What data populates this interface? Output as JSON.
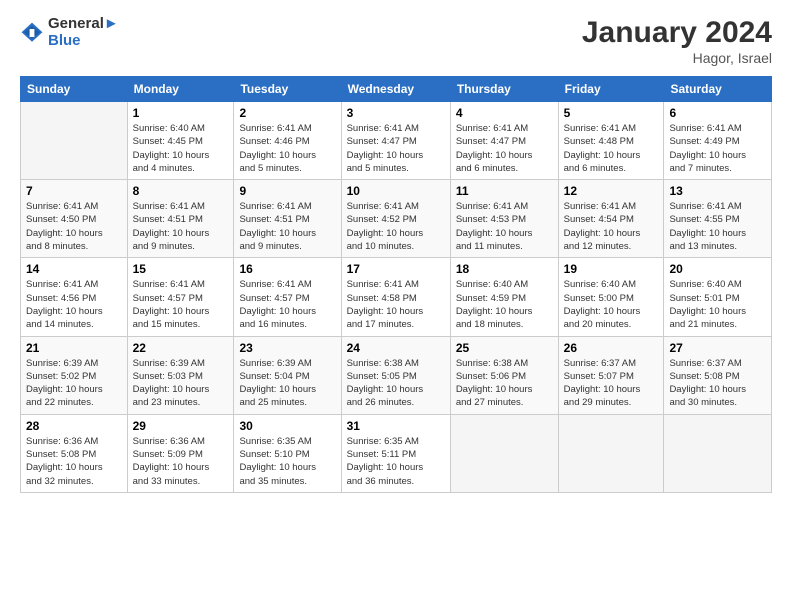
{
  "header": {
    "logo_line1": "General",
    "logo_line2": "Blue",
    "title": "January 2024",
    "subtitle": "Hagor, Israel"
  },
  "columns": [
    "Sunday",
    "Monday",
    "Tuesday",
    "Wednesday",
    "Thursday",
    "Friday",
    "Saturday"
  ],
  "rows": [
    [
      {
        "num": "",
        "info": ""
      },
      {
        "num": "1",
        "info": "Sunrise: 6:40 AM\nSunset: 4:45 PM\nDaylight: 10 hours\nand 4 minutes."
      },
      {
        "num": "2",
        "info": "Sunrise: 6:41 AM\nSunset: 4:46 PM\nDaylight: 10 hours\nand 5 minutes."
      },
      {
        "num": "3",
        "info": "Sunrise: 6:41 AM\nSunset: 4:47 PM\nDaylight: 10 hours\nand 5 minutes."
      },
      {
        "num": "4",
        "info": "Sunrise: 6:41 AM\nSunset: 4:47 PM\nDaylight: 10 hours\nand 6 minutes."
      },
      {
        "num": "5",
        "info": "Sunrise: 6:41 AM\nSunset: 4:48 PM\nDaylight: 10 hours\nand 6 minutes."
      },
      {
        "num": "6",
        "info": "Sunrise: 6:41 AM\nSunset: 4:49 PM\nDaylight: 10 hours\nand 7 minutes."
      }
    ],
    [
      {
        "num": "7",
        "info": "Sunrise: 6:41 AM\nSunset: 4:50 PM\nDaylight: 10 hours\nand 8 minutes."
      },
      {
        "num": "8",
        "info": "Sunrise: 6:41 AM\nSunset: 4:51 PM\nDaylight: 10 hours\nand 9 minutes."
      },
      {
        "num": "9",
        "info": "Sunrise: 6:41 AM\nSunset: 4:51 PM\nDaylight: 10 hours\nand 9 minutes."
      },
      {
        "num": "10",
        "info": "Sunrise: 6:41 AM\nSunset: 4:52 PM\nDaylight: 10 hours\nand 10 minutes."
      },
      {
        "num": "11",
        "info": "Sunrise: 6:41 AM\nSunset: 4:53 PM\nDaylight: 10 hours\nand 11 minutes."
      },
      {
        "num": "12",
        "info": "Sunrise: 6:41 AM\nSunset: 4:54 PM\nDaylight: 10 hours\nand 12 minutes."
      },
      {
        "num": "13",
        "info": "Sunrise: 6:41 AM\nSunset: 4:55 PM\nDaylight: 10 hours\nand 13 minutes."
      }
    ],
    [
      {
        "num": "14",
        "info": "Sunrise: 6:41 AM\nSunset: 4:56 PM\nDaylight: 10 hours\nand 14 minutes."
      },
      {
        "num": "15",
        "info": "Sunrise: 6:41 AM\nSunset: 4:57 PM\nDaylight: 10 hours\nand 15 minutes."
      },
      {
        "num": "16",
        "info": "Sunrise: 6:41 AM\nSunset: 4:57 PM\nDaylight: 10 hours\nand 16 minutes."
      },
      {
        "num": "17",
        "info": "Sunrise: 6:41 AM\nSunset: 4:58 PM\nDaylight: 10 hours\nand 17 minutes."
      },
      {
        "num": "18",
        "info": "Sunrise: 6:40 AM\nSunset: 4:59 PM\nDaylight: 10 hours\nand 18 minutes."
      },
      {
        "num": "19",
        "info": "Sunrise: 6:40 AM\nSunset: 5:00 PM\nDaylight: 10 hours\nand 20 minutes."
      },
      {
        "num": "20",
        "info": "Sunrise: 6:40 AM\nSunset: 5:01 PM\nDaylight: 10 hours\nand 21 minutes."
      }
    ],
    [
      {
        "num": "21",
        "info": "Sunrise: 6:39 AM\nSunset: 5:02 PM\nDaylight: 10 hours\nand 22 minutes."
      },
      {
        "num": "22",
        "info": "Sunrise: 6:39 AM\nSunset: 5:03 PM\nDaylight: 10 hours\nand 23 minutes."
      },
      {
        "num": "23",
        "info": "Sunrise: 6:39 AM\nSunset: 5:04 PM\nDaylight: 10 hours\nand 25 minutes."
      },
      {
        "num": "24",
        "info": "Sunrise: 6:38 AM\nSunset: 5:05 PM\nDaylight: 10 hours\nand 26 minutes."
      },
      {
        "num": "25",
        "info": "Sunrise: 6:38 AM\nSunset: 5:06 PM\nDaylight: 10 hours\nand 27 minutes."
      },
      {
        "num": "26",
        "info": "Sunrise: 6:37 AM\nSunset: 5:07 PM\nDaylight: 10 hours\nand 29 minutes."
      },
      {
        "num": "27",
        "info": "Sunrise: 6:37 AM\nSunset: 5:08 PM\nDaylight: 10 hours\nand 30 minutes."
      }
    ],
    [
      {
        "num": "28",
        "info": "Sunrise: 6:36 AM\nSunset: 5:08 PM\nDaylight: 10 hours\nand 32 minutes."
      },
      {
        "num": "29",
        "info": "Sunrise: 6:36 AM\nSunset: 5:09 PM\nDaylight: 10 hours\nand 33 minutes."
      },
      {
        "num": "30",
        "info": "Sunrise: 6:35 AM\nSunset: 5:10 PM\nDaylight: 10 hours\nand 35 minutes."
      },
      {
        "num": "31",
        "info": "Sunrise: 6:35 AM\nSunset: 5:11 PM\nDaylight: 10 hours\nand 36 minutes."
      },
      {
        "num": "",
        "info": ""
      },
      {
        "num": "",
        "info": ""
      },
      {
        "num": "",
        "info": ""
      }
    ]
  ]
}
